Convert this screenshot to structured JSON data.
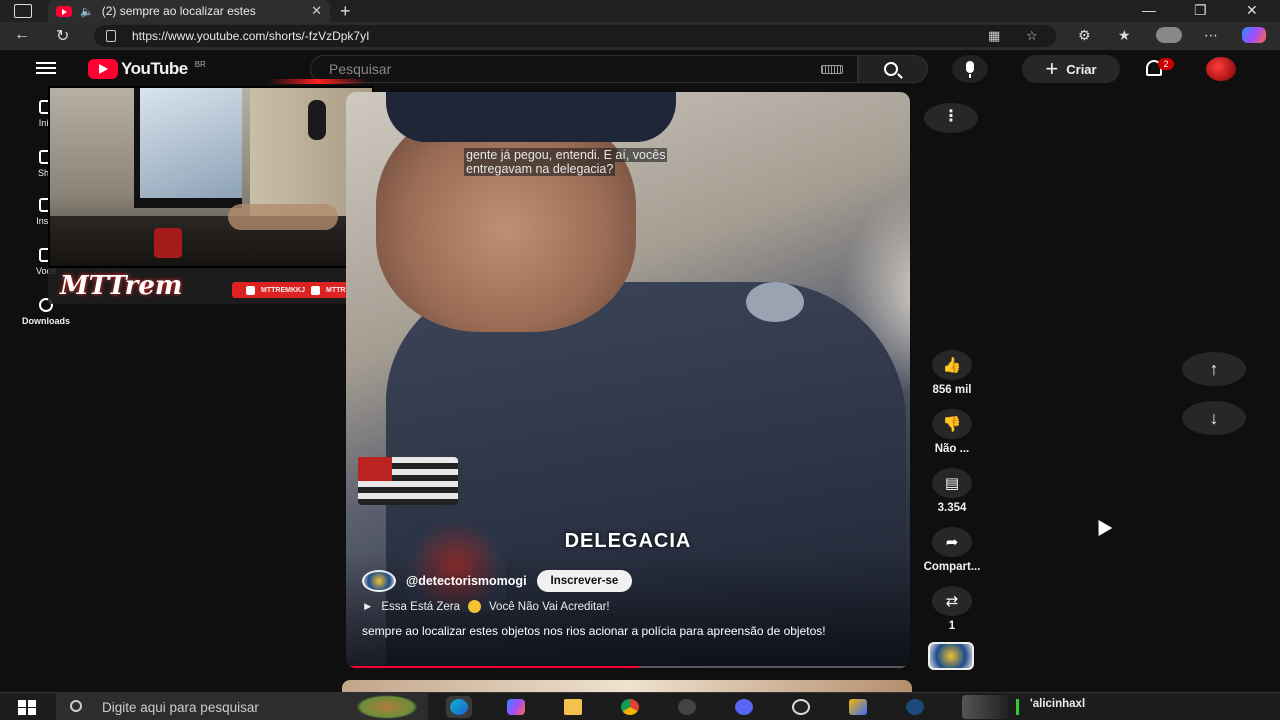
{
  "browser": {
    "tab_title": "(2) sempre ao localizar estes",
    "url": "https://www.youtube.com/shorts/-fzVzDpk7yI"
  },
  "youtube": {
    "logo_text": "YouTube",
    "region": "BR",
    "search_placeholder": "Pesquisar",
    "create_label": "Criar",
    "notification_count": "2",
    "guide": [
      {
        "label": "Iníc"
      },
      {
        "label": "Sho"
      },
      {
        "label": "Inscr"
      },
      {
        "label": "Você"
      },
      {
        "label": "Downloads"
      }
    ]
  },
  "stream_overlay": {
    "brand_text": "MTTrem",
    "social_instagram": "MTTREMKKJ",
    "social_youtube": "MTTREM"
  },
  "short": {
    "subtitle_line1": "gente já pegou, entendi. E aí, vocês",
    "subtitle_line2": "entregavam na delegacia?",
    "overlay_text": "DELEGACIA",
    "channel": "@detectorismomogi",
    "subscribe_label": "Inscrever-se",
    "music": "Essa Está Zera",
    "music_tail": "Você Não Vai Acreditar!",
    "description": "sempre ao localizar estes objetos nos rios acionar a polícia para apreensão de objetos!",
    "progress": 0.52
  },
  "actions": {
    "likes": "856 mil",
    "dislike_label": "Não ...",
    "comments": "3.354",
    "share_label": "Compart...",
    "remix_count": "1"
  },
  "taskbar": {
    "search_placeholder": "Digite aqui para pesquisar",
    "user_name": "'alicinhaxl"
  },
  "colors": {
    "background": "#0f0f0f",
    "youtube_red": "#ff0033",
    "chip": "#272727"
  }
}
